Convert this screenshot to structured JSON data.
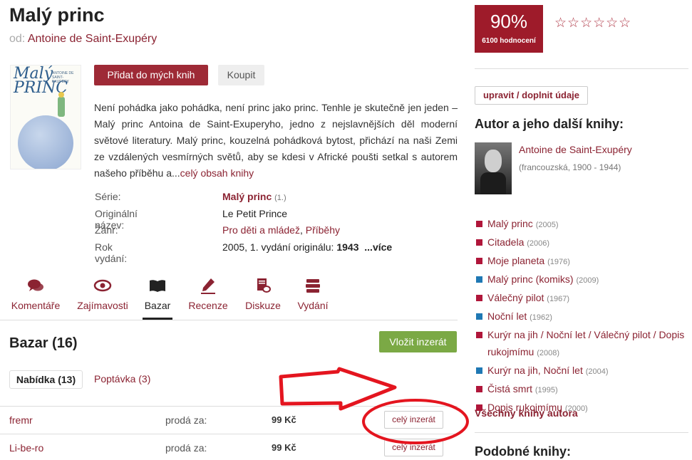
{
  "book": {
    "title": "Malý princ",
    "by_prefix": "od:",
    "author": "Antoine de Saint-Exupéry",
    "description": "Není pohádka jako pohádka, není princ jako princ. Tenhle je skutečně jen jeden – Malý princ Antoina de Saint-Exuperyho, jedno z nejslavnějších děl moderní světové literatury. Malý princ, kouzelná pohádková bytost, přichází na naši Zemi ze vzdálených vesmírných světů, aby se kdesi v Africké poušti setkal s autorem našeho příběhu a...",
    "more_link": "celý obsah knihy"
  },
  "cover": {
    "title": "Malý PRINC",
    "author": "ANTOINE DE SAINT-EXUPÉRY"
  },
  "actions": {
    "add": "Přidat do mých knih",
    "buy": "Koupit"
  },
  "meta": {
    "series_label": "Série:",
    "series_value": "Malý princ",
    "series_num": "(1.)",
    "orig_label": "Originální název:",
    "orig_value": "Le Petit Prince",
    "genre_label": "Žánr:",
    "genre_1": "Pro děti a mládež",
    "genre_sep": ",",
    "genre_2": "Příběhy",
    "year_label": "Rok vydání:",
    "year_value": "2005, 1. vydání originálu:",
    "year_orig": "1943",
    "year_more": "...více"
  },
  "tabs": [
    {
      "label": "Komentáře",
      "icon": "comments-icon"
    },
    {
      "label": "Zajímavosti",
      "icon": "eye-icon"
    },
    {
      "label": "Bazar",
      "icon": "book-icon"
    },
    {
      "label": "Recenze",
      "icon": "pen-icon"
    },
    {
      "label": "Diskuze",
      "icon": "discussion-icon"
    },
    {
      "label": "Vydání",
      "icon": "books-stack-icon"
    }
  ],
  "bazar": {
    "title": "Bazar (16)",
    "add_button": "Vložit inzerát",
    "subtab_offer": "Nabídka (13)",
    "subtab_demand": "Poptávka (3)",
    "offers": [
      {
        "user": "fremr",
        "label": "prodá za:",
        "price": "99 Kč",
        "button": "celý inzerát"
      },
      {
        "user": "Li-be-ro",
        "label": "prodá za:",
        "price": "99 Kč",
        "button": "celý inzerát"
      }
    ]
  },
  "rating": {
    "percent": "90%",
    "count": "6100 hodnocení",
    "stars": "☆☆☆☆☆☆"
  },
  "sidebar": {
    "edit_button": "upravit / doplnit údaje",
    "author_heading": "Autor a jeho další knihy:",
    "author_name": "Antoine de Saint-Exupéry",
    "author_info": "(francouzská, 1900 - 1944)",
    "books": [
      {
        "title": "Malý princ",
        "year": "(2005)",
        "color": "#b0163a"
      },
      {
        "title": "Citadela",
        "year": "(2006)",
        "color": "#b0163a"
      },
      {
        "title": "Moje planeta",
        "year": "(1976)",
        "color": "#b0163a"
      },
      {
        "title": "Malý princ (komiks)",
        "year": "(2009)",
        "color": "#1f78b4"
      },
      {
        "title": "Válečný pilot",
        "year": "(1967)",
        "color": "#b0163a"
      },
      {
        "title": "Noční let",
        "year": "(1962)",
        "color": "#1f78b4"
      },
      {
        "title": "Kurýr na jih / Noční let / Válečný pilot / Dopis rukojmímu",
        "year": "(2008)",
        "color": "#b0163a"
      },
      {
        "title": "Kurýr na jih, Noční let",
        "year": "(2004)",
        "color": "#1f78b4"
      },
      {
        "title": "Čistá smrt",
        "year": "(1995)",
        "color": "#b0163a"
      },
      {
        "title": "Dopis rukojmímu",
        "year": "(2000)",
        "color": "#b0163a"
      }
    ],
    "all_books": "Všechny knihy autora",
    "similar_heading": "Podobné knihy:"
  }
}
